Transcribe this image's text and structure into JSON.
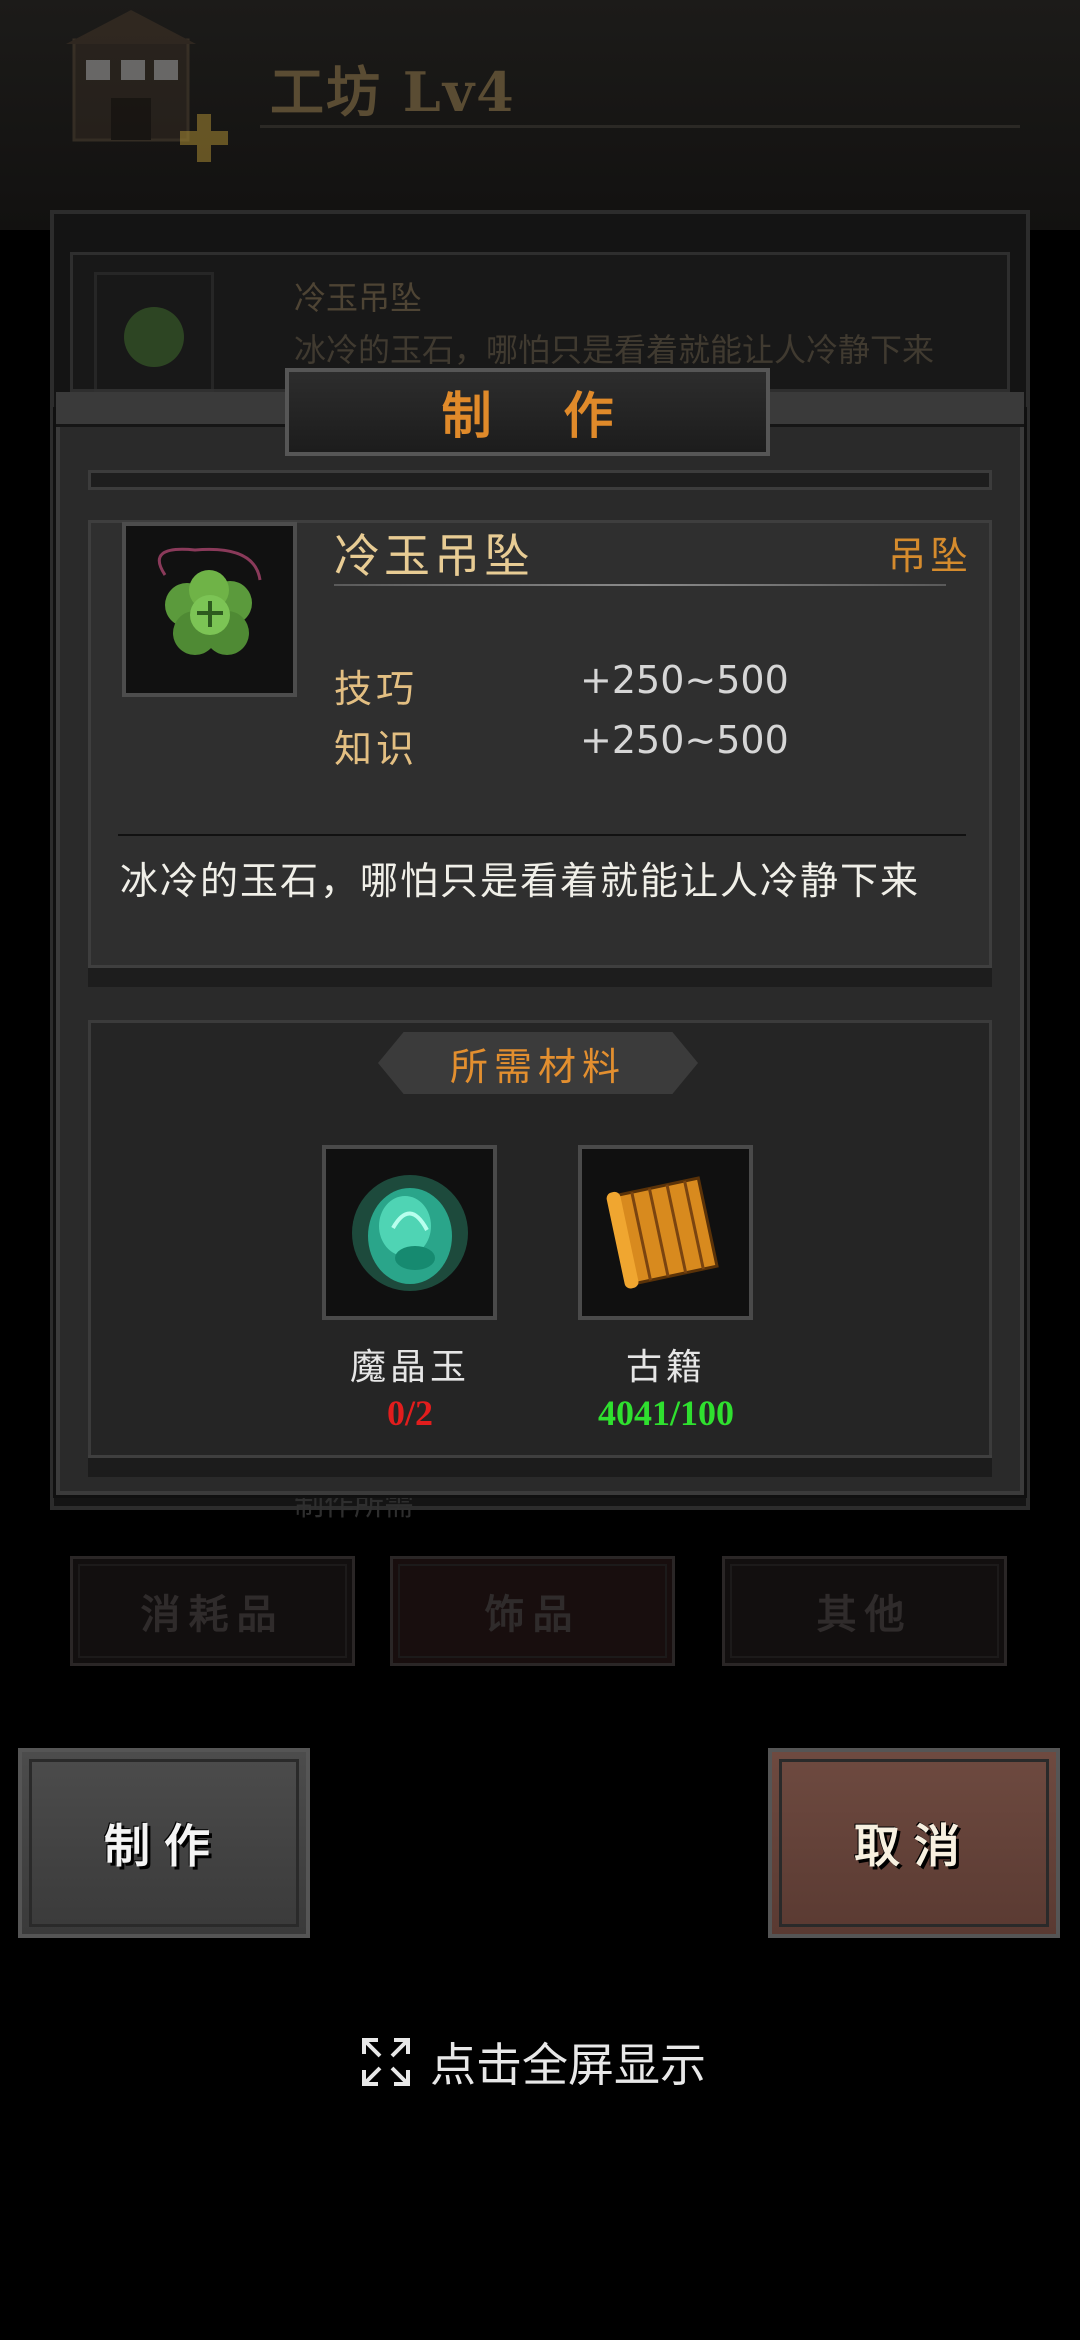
{
  "header": {
    "title": "工坊 Lv4",
    "bg_item_name": "冷玉吊坠",
    "bg_item_desc": "冰冷的玉石，哪怕只是看着就能让人冷静下来",
    "bg_partial_text": "制作所需"
  },
  "categories": {
    "consumables": "消耗品",
    "accessories": "饰品",
    "others": "其他"
  },
  "modal": {
    "title": "制作",
    "item": {
      "icon": "jade-pendant-icon",
      "name": "冷玉吊坠",
      "type": "吊坠",
      "stats": [
        {
          "label": "技巧",
          "value": "+250~500"
        },
        {
          "label": "知识",
          "value": "+250~500"
        }
      ],
      "description": "冰冷的玉石，哪怕只是看着就能让人冷静下来"
    },
    "materials_header": "所需材料",
    "materials": [
      {
        "icon": "magic-crystal-jade-icon",
        "name": "魔晶玉",
        "count": "0/2",
        "status_color": "#e21d1d"
      },
      {
        "icon": "ancient-scroll-icon",
        "name": "古籍",
        "count": "4041/100",
        "status_color": "#2fe02f"
      }
    ]
  },
  "actions": {
    "craft": "制作",
    "cancel": "取消"
  },
  "fullscreen_hint": "点击全屏显示",
  "colors": {
    "accent_orange": "#e08a2a",
    "gold_text": "#e8cc94",
    "insufficient": "#e21d1d",
    "sufficient": "#2fe02f"
  }
}
